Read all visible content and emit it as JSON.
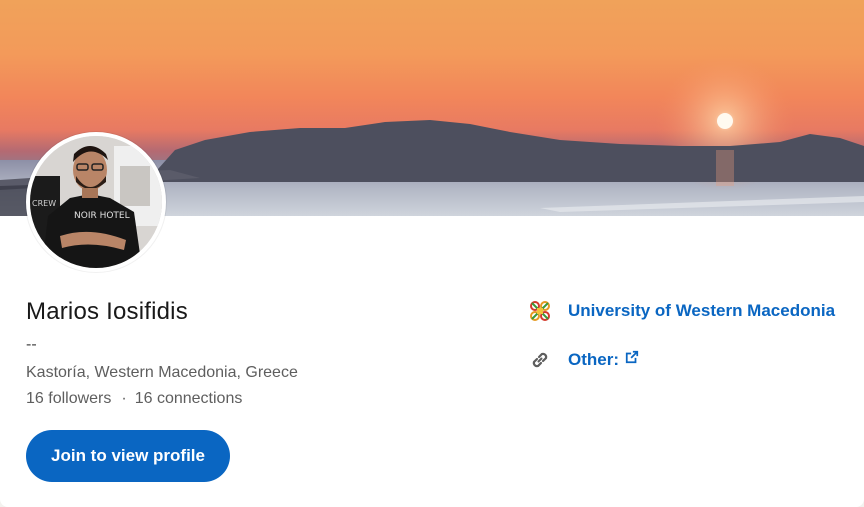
{
  "profile": {
    "name": "Marios Iosifidis",
    "headline": "--",
    "location": "Kastoría, Western Macedonia, Greece",
    "followers": "16 followers",
    "separator": "·",
    "connections": "16 connections"
  },
  "actions": {
    "join_label": "Join to view profile"
  },
  "sidebar": {
    "education": "University of Western Macedonia",
    "other_label": "Other:"
  },
  "colors": {
    "accent": "#0a66c2",
    "name_text": "#191919",
    "muted_text": "#5e5e5e"
  },
  "icons": {
    "education": "university-logo-icon",
    "website": "link-icon",
    "external": "external-link-icon"
  }
}
